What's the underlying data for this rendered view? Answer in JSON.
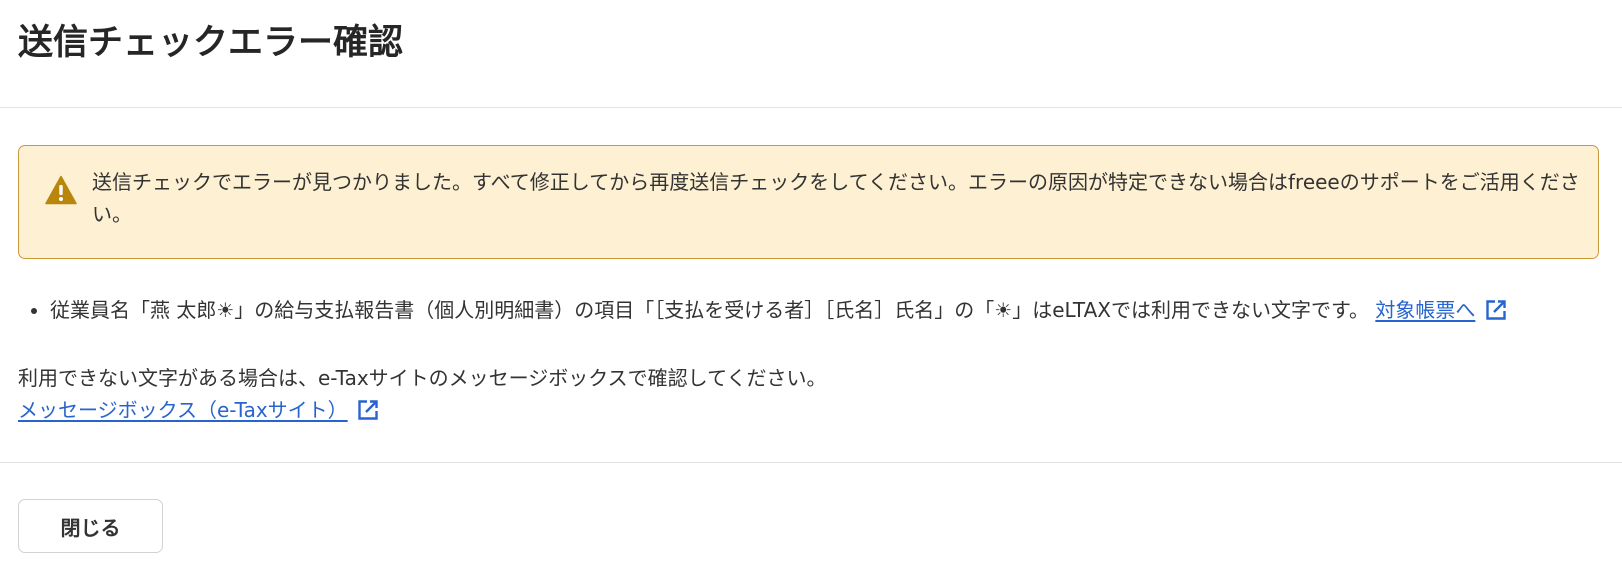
{
  "dialog": {
    "title": "送信チェックエラー確認"
  },
  "alert": {
    "icon": "warning-triangle-icon",
    "message": "送信チェックでエラーが見つかりました。すべて修正してから再度送信チェックをしてください。エラーの原因が特定できない場合はfreeeのサポートをご活用ください。"
  },
  "errors": [
    {
      "text": "従業員名「燕 太郎☀」の給与支払報告書（個人別明細書）の項目「［支払を受ける者］［氏名］氏名」の「☀」はeLTAXでは利用できない文字です。",
      "link_label": "対象帳票へ",
      "link_icon": "external-link-icon"
    }
  ],
  "note": {
    "text": "利用できない文字がある場合は、e-Taxサイトのメッセージボックスで確認してください。",
    "link_label": "メッセージボックス（e-Taxサイト）",
    "link_icon": "external-link-icon"
  },
  "footer": {
    "close_label": "閉じる"
  },
  "colors": {
    "alert_background": "#fdf0d3",
    "alert_border": "#c99a3c",
    "warning_icon": "#b8860b",
    "link": "#2864cf"
  }
}
